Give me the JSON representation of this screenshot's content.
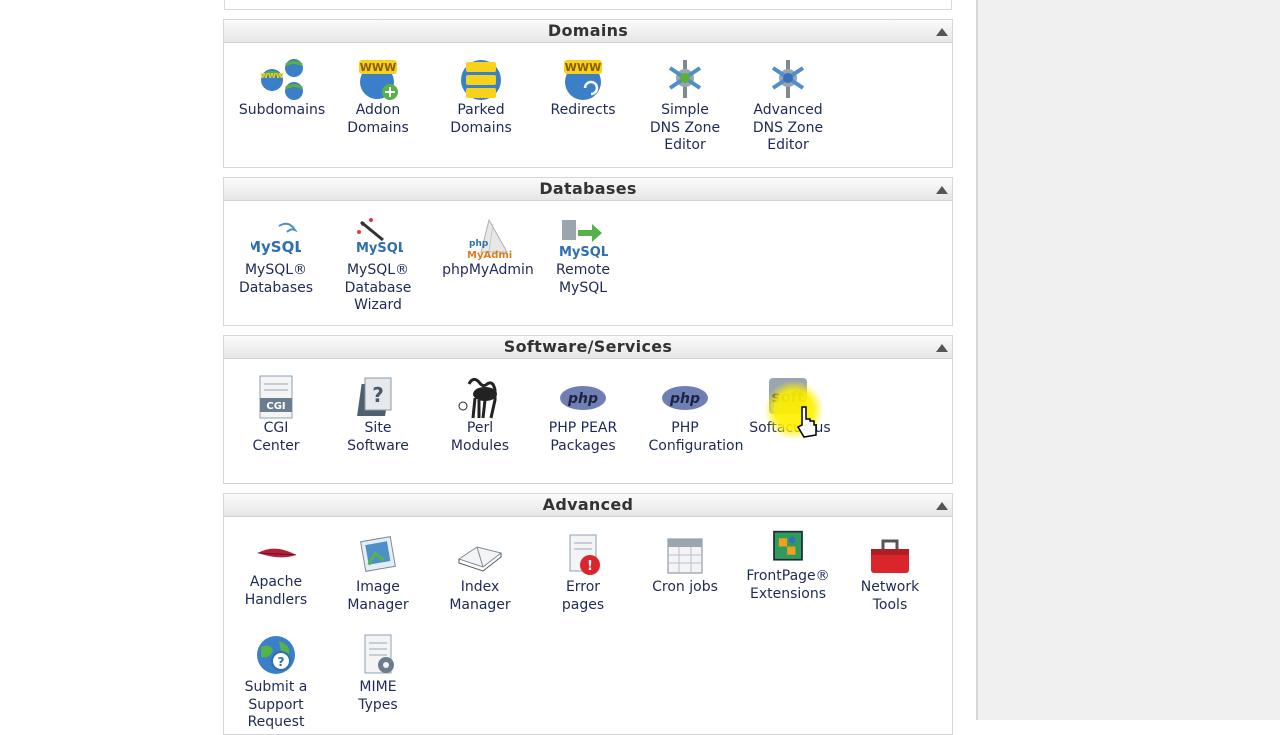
{
  "sections": {
    "domains": {
      "title": "Domains",
      "items": [
        {
          "l1": "Subdomains",
          "l2": "",
          "l3": ""
        },
        {
          "l1": "Addon",
          "l2": "Domains",
          "l3": ""
        },
        {
          "l1": "Parked",
          "l2": "Domains",
          "l3": ""
        },
        {
          "l1": "Redirects",
          "l2": "",
          "l3": ""
        },
        {
          "l1": "Simple",
          "l2": "DNS Zone",
          "l3": "Editor"
        },
        {
          "l1": "Advanced",
          "l2": "DNS Zone",
          "l3": "Editor"
        }
      ]
    },
    "databases": {
      "title": "Databases",
      "items": [
        {
          "l1": "MySQL®",
          "l2": "Databases",
          "l3": ""
        },
        {
          "l1": "MySQL®",
          "l2": "Database",
          "l3": "Wizard"
        },
        {
          "l1": "phpMyAdmin",
          "l2": "",
          "l3": ""
        },
        {
          "l1": "Remote",
          "l2": "MySQL",
          "l3": ""
        }
      ]
    },
    "software": {
      "title": "Software/Services",
      "items": [
        {
          "l1": "CGI",
          "l2": "Center",
          "l3": ""
        },
        {
          "l1": "Site",
          "l2": "Software",
          "l3": ""
        },
        {
          "l1": "Perl",
          "l2": "Modules",
          "l3": ""
        },
        {
          "l1": "PHP PEAR",
          "l2": "Packages",
          "l3": ""
        },
        {
          "l1": "PHP",
          "l2": "Configuration",
          "l3": ""
        },
        {
          "l1": "Softaculous",
          "l2": "",
          "l3": ""
        }
      ]
    },
    "advanced": {
      "title": "Advanced",
      "items": [
        {
          "l1": "Apache",
          "l2": "Handlers",
          "l3": ""
        },
        {
          "l1": "Image",
          "l2": "Manager",
          "l3": ""
        },
        {
          "l1": "Index",
          "l2": "Manager",
          "l3": ""
        },
        {
          "l1": "Error",
          "l2": "pages",
          "l3": ""
        },
        {
          "l1": "Cron jobs",
          "l2": "",
          "l3": ""
        },
        {
          "l1": "FrontPage®",
          "l2": "Extensions",
          "l3": ""
        },
        {
          "l1": "Network",
          "l2": "Tools",
          "l3": ""
        },
        {
          "l1": "Submit a",
          "l2": "Support",
          "l3": "Request"
        },
        {
          "l1": "MIME",
          "l2": "Types",
          "l3": ""
        }
      ]
    }
  },
  "icons": {
    "www_text": "WWW",
    "mysql_text": "MySQL",
    "php_text": "php",
    "cgi_text": "CGI",
    "soft_text": "soft",
    "pma_text": "MyAdmin"
  }
}
